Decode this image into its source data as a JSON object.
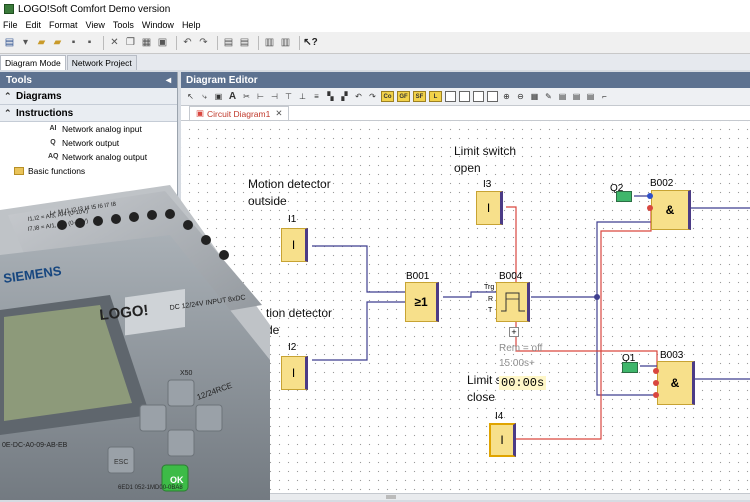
{
  "window": {
    "title": "LOGO!Soft Comfort Demo version"
  },
  "menu": [
    "File",
    "Edit",
    "Format",
    "View",
    "Tools",
    "Window",
    "Help"
  ],
  "mode_tabs": [
    "Diagram Mode",
    "Network Project"
  ],
  "tools": {
    "title": "Tools",
    "sections": {
      "diagrams": "Diagrams",
      "instructions": "Instructions"
    },
    "items": [
      {
        "icon": "AI",
        "label": "Network analog input"
      },
      {
        "icon": "Q",
        "label": "Network output"
      },
      {
        "icon": "AQ",
        "label": "Network analog output"
      }
    ],
    "folder": "Basic functions"
  },
  "editor": {
    "title": "Diagram Editor",
    "tab": "Circuit Diagram1",
    "labels": {
      "motion_outside_1": "Motion detector",
      "motion_outside_2": "outside",
      "motion_inside_1": "tion detector",
      "motion_inside_2": "de",
      "limit_open_1": "Limit switch",
      "limit_open_2": "open",
      "limit_close_1": "Limit s",
      "limit_close_2": "close"
    },
    "blocks": {
      "i1": {
        "name": "I1",
        "symbol": "I"
      },
      "i2": {
        "name": "I2",
        "symbol": "I"
      },
      "i3": {
        "name": "I3",
        "symbol": "I"
      },
      "i4": {
        "name": "I4",
        "symbol": "I"
      },
      "b001": {
        "name": "B001",
        "symbol": "≥1"
      },
      "b004": {
        "name": "B004",
        "pins": [
          "Trg",
          "R",
          "T"
        ]
      },
      "b002": {
        "name": "B002",
        "symbol": "&"
      },
      "b003": {
        "name": "B003",
        "symbol": "&"
      },
      "q1": {
        "name": "Q1"
      },
      "q2": {
        "name": "Q2"
      }
    },
    "timer": {
      "rem": "Rem = off",
      "preset": "15:00s+",
      "current": "00:00s",
      "expand": "+"
    }
  },
  "photo": {
    "brand": "SIEMENS",
    "product": "LOGO!",
    "supply": "DC 12/24V  INPUT 8xDC",
    "terminals": "L+  M  I1  I2  I3  I4  I5  I6  I7  I8",
    "variant": "12/24RCE",
    "ok": "OK",
    "esc": "ESC",
    "serial": "6ED1 052-1MD00-0BA8",
    "order": "0E-DC-A0-09-AB-EB",
    "outputs": "X50",
    "note1": "I1,I2 = AI3, AI4 (0-10V)",
    "note2": "I7,I8 = AI1, AI2 (0-10V)"
  },
  "colors": {
    "wire_red": "#d9473f",
    "wire_blue": "#3f3f8f",
    "block_fill": "#f7e08b",
    "header": "#5d7290"
  }
}
